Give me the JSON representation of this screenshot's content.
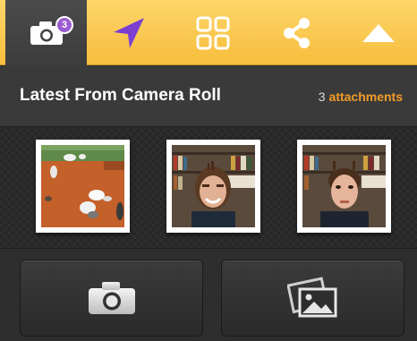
{
  "tabs": {
    "camera_badge": "3"
  },
  "header": {
    "title": "Latest From Camera Roll",
    "count": "3",
    "count_label": "attachments"
  },
  "photos": [
    {
      "name": "photo-dogs-on-dirt"
    },
    {
      "name": "photo-girl-with-bookshelf"
    },
    {
      "name": "photo-boy-with-bookshelf"
    }
  ],
  "colors": {
    "tab_bar": "#f7be3c",
    "active_tab": "#444444",
    "accent_orange": "#f29c28",
    "badge_purple": "#9c5bd0",
    "location_arrow": "#7b3fd1"
  },
  "icons": {
    "camera_tab": "camera-icon",
    "location_tab": "location-arrow-icon",
    "grid_tab": "grid-icon",
    "share_tab": "share-icon",
    "collapse_tab": "triangle-up-icon",
    "camera_button": "camera-icon",
    "photos_button": "photo-library-icon"
  }
}
